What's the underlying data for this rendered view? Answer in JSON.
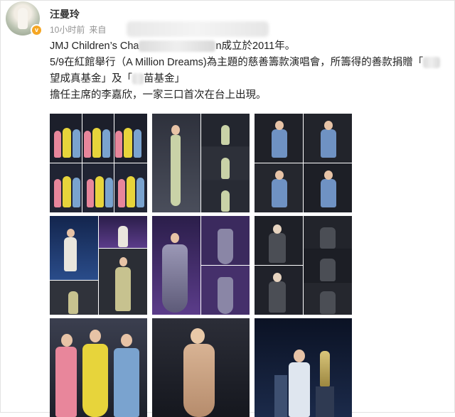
{
  "post": {
    "username": "汪曼玲",
    "badge": "v",
    "time": "10小时前",
    "source_prefix": "来自",
    "lines": [
      {
        "before": "JMJ Children’s Cha",
        "after": "n成立於2011年。"
      },
      {
        "before": "5/9在紅館舉行（A Million Dreams)為主題的慈善籌款演唱會，所籌得的善款捐贈「",
        "after": ""
      },
      {
        "before": "望成真基金」及「",
        "after": "苗基金」"
      },
      {
        "before": "擔任主席的李嘉欣，一家三口首次在台上出現。",
        "after": ""
      }
    ]
  },
  "photos": [
    "photo-collage-family-stage",
    "photo-collage-singer-green-dress",
    "photo-collage-singer-denim-jacket",
    "photo-collage-singer-blue-stage",
    "photo-collage-singer-sequin-gown",
    "photo-collage-singer-grey-jacket",
    "photo-family-on-stage",
    "photo-singer-gold-dress",
    "photo-singer-with-trophy"
  ],
  "colors": {
    "accent_badge": "#f5a623",
    "text_main": "#222222",
    "text_meta": "#939393"
  }
}
